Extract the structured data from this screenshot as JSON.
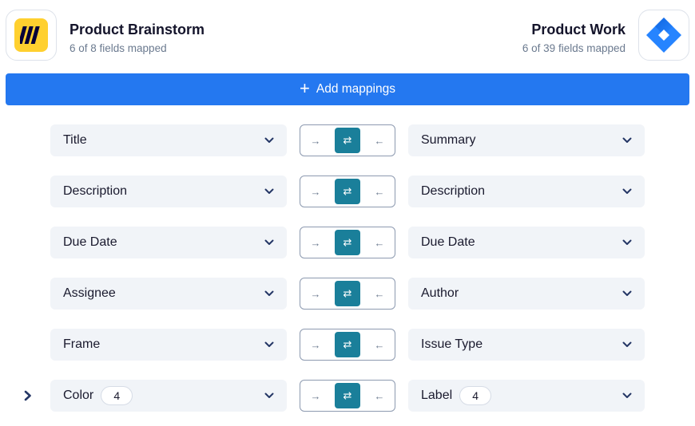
{
  "left_app": {
    "name": "Product Brainstorm",
    "subtitle": "6 of 8 fields mapped",
    "icon": "miro-logo-icon",
    "brand_color": "#ffd02f"
  },
  "right_app": {
    "name": "Product Work",
    "subtitle": "6 of 39 fields mapped",
    "icon": "jira-logo-icon",
    "brand_color": "#2684ff"
  },
  "add_button": {
    "label": "Add mappings",
    "icon": "plus-icon",
    "color": "#2478f0"
  },
  "direction_options": {
    "left_to_right": "→",
    "two_way": "⇄",
    "right_to_left": "←",
    "active": "two_way",
    "active_color": "#1a7f9a"
  },
  "mappings": [
    {
      "left": "Title",
      "right": "Summary",
      "direction": "two_way"
    },
    {
      "left": "Description",
      "right": "Description",
      "direction": "two_way"
    },
    {
      "left": "Due Date",
      "right": "Due Date",
      "direction": "two_way"
    },
    {
      "left": "Assignee",
      "right": "Author",
      "direction": "two_way"
    },
    {
      "left": "Frame",
      "right": "Issue Type",
      "direction": "two_way"
    },
    {
      "left": "Color",
      "left_count": "4",
      "right": "Label",
      "right_count": "4",
      "direction": "two_way",
      "expandable": true
    }
  ]
}
